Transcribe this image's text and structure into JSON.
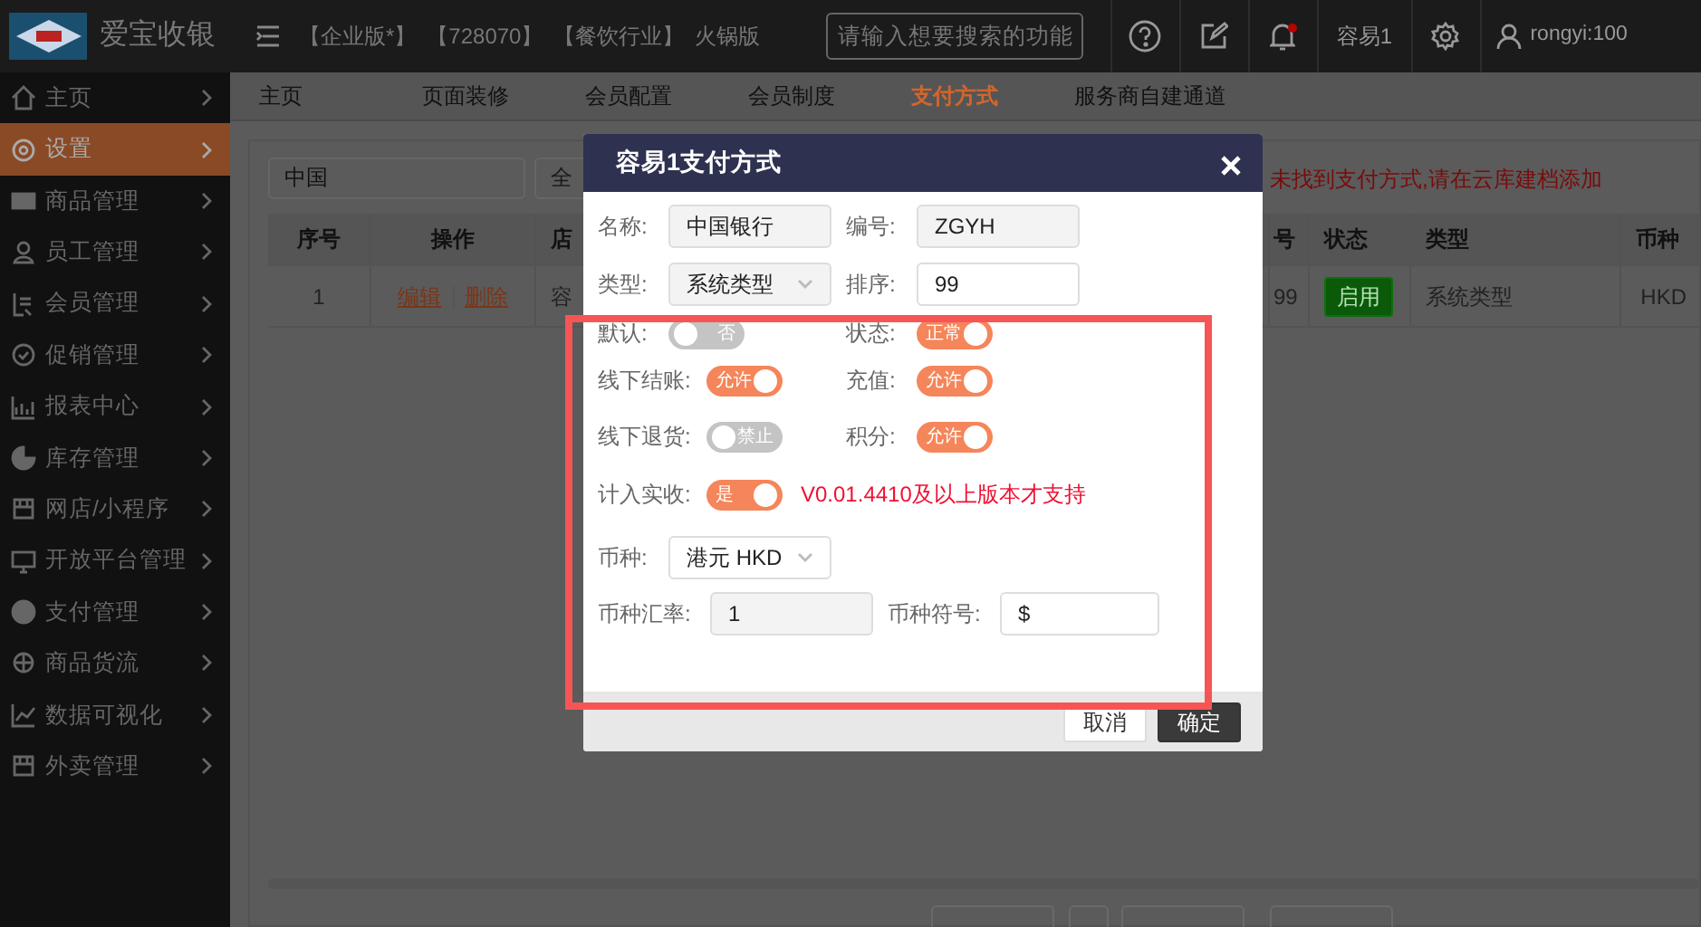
{
  "topbar": {
    "logo_text": "爱宝收银",
    "tags": [
      "【企业版*】",
      "【728070】",
      "【餐饮行业】",
      "火锅版"
    ],
    "search": {
      "placeholder": "请输入想要搜索的功能"
    },
    "notification_dot": true,
    "store": "容易1",
    "user": "rongyi:100"
  },
  "sidebar": {
    "items": [
      {
        "label": "主页",
        "selected": false
      },
      {
        "label": "设置",
        "selected": true
      },
      {
        "label": "商品管理",
        "selected": false
      },
      {
        "label": "员工管理",
        "selected": false
      },
      {
        "label": "会员管理",
        "selected": false
      },
      {
        "label": "促销管理",
        "selected": false
      },
      {
        "label": "报表中心",
        "selected": false
      },
      {
        "label": "库存管理",
        "selected": false
      },
      {
        "label": "网店/小程序",
        "selected": false
      },
      {
        "label": "开放平台管理",
        "selected": false
      },
      {
        "label": "支付管理",
        "selected": false
      },
      {
        "label": "商品货流",
        "selected": false
      },
      {
        "label": "数据可视化",
        "selected": false
      },
      {
        "label": "外卖管理",
        "selected": false
      }
    ]
  },
  "tabs": [
    {
      "label": "主页",
      "selected": false
    },
    {
      "label": "页面装修",
      "selected": false
    },
    {
      "label": "会员配置",
      "selected": false
    },
    {
      "label": "会员制度",
      "selected": false
    },
    {
      "label": "支付方式",
      "selected": true
    },
    {
      "label": "服务商自建通道",
      "selected": false
    }
  ],
  "content": {
    "search_value": "中国",
    "filter_select": "全",
    "notice": "未找到支付方式,请在云库建档添加",
    "table": {
      "columns": [
        "序号",
        "操作",
        "店",
        "号",
        "状态",
        "类型",
        "币种"
      ],
      "rows": [
        {
          "index": "1",
          "actions": [
            "编辑",
            "删除"
          ],
          "store": "容",
          "number": "99",
          "status": "启用",
          "type": "系统类型",
          "currency": "HKD"
        }
      ]
    }
  },
  "dialog": {
    "title": "容易1支付方式",
    "name_label": "名称:",
    "name": "中国银行",
    "code_label": "编号:",
    "code": "ZGYH",
    "type_label": "类型:",
    "type": "系统类型",
    "sort_label": "排序:",
    "sort": "99",
    "toggles": [
      {
        "label": "默认:",
        "text": "否",
        "on": false
      },
      {
        "label": "状态:",
        "text": "正常",
        "on": true
      },
      {
        "label": "线下结账:",
        "text": "允许",
        "on": true
      },
      {
        "label": "充值:",
        "text": "允许",
        "on": true
      },
      {
        "label": "线下退货:",
        "text": "禁止",
        "on": false
      },
      {
        "label": "积分:",
        "text": "允许",
        "on": true
      },
      {
        "label": "计入实收:",
        "text": "是",
        "on": true
      }
    ],
    "version_note": "V0.01.4410及以上版本才支持",
    "currency_label": "币种:",
    "currency": "港元 HKD",
    "rate_label": "币种汇率:",
    "rate": "1",
    "symbol_label": "币种符号:",
    "symbol": "$",
    "buttons": [
      {
        "label": "取消",
        "kind": "secondary"
      },
      {
        "label": "确定",
        "kind": "primary"
      }
    ]
  }
}
